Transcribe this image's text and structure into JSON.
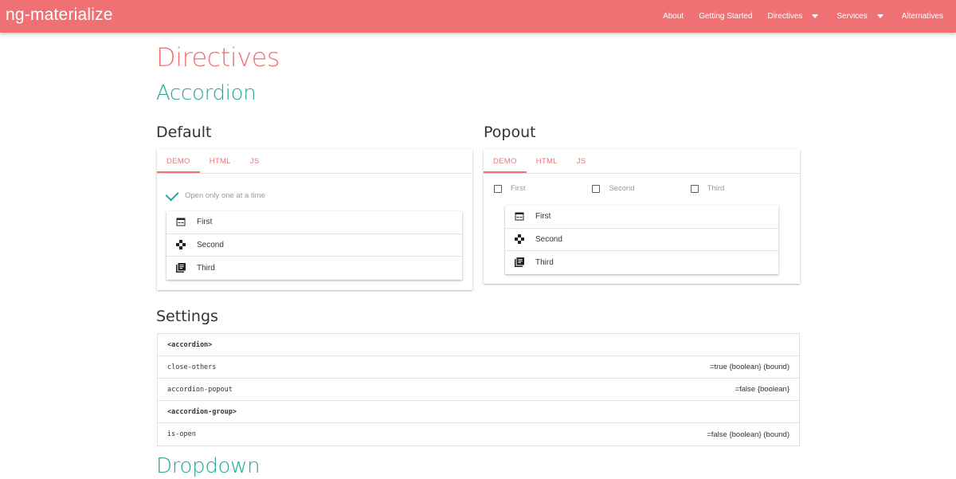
{
  "navbar": {
    "brand": "ng-materialize",
    "links": [
      {
        "label": "About"
      },
      {
        "label": "Getting Started"
      },
      {
        "label": "Directives"
      },
      {
        "label": "Services"
      },
      {
        "label": "Alternatives"
      }
    ]
  },
  "headings": {
    "directives": "Directives",
    "accordion": "Accordion",
    "default": "Default",
    "popout": "Popout",
    "settings": "Settings",
    "dropdown": "Dropdown"
  },
  "default_card": {
    "tabs": [
      "DEMO",
      "HTML",
      "JS"
    ],
    "option_label": "Open only one at a time",
    "items": [
      {
        "label": "First",
        "icon": "web-asset-icon"
      },
      {
        "label": "Second",
        "icon": "gamepad-icon"
      },
      {
        "label": "Third",
        "icon": "library-books-icon"
      }
    ]
  },
  "popout_card": {
    "tabs": [
      "DEMO",
      "HTML",
      "JS"
    ],
    "checkboxes": [
      "First",
      "Second",
      "Third"
    ],
    "items": [
      {
        "label": "First",
        "icon": "web-asset-icon"
      },
      {
        "label": "Second",
        "icon": "gamepad-icon"
      },
      {
        "label": "Third",
        "icon": "library-books-icon"
      }
    ]
  },
  "settings": [
    {
      "name": "<accordion>",
      "value": "",
      "bold": true
    },
    {
      "name": "close-others",
      "value": "=true {boolean} (bound)",
      "bold": false
    },
    {
      "name": "accordion-popout",
      "value": "=false {boolean}",
      "bold": false
    },
    {
      "name": "<accordion-group>",
      "value": "",
      "bold": true
    },
    {
      "name": "is-open",
      "value": "=false {boolean} (bound)",
      "bold": false
    }
  ],
  "colors": {
    "primary": "#ef7174",
    "accent": "#26a69a"
  }
}
